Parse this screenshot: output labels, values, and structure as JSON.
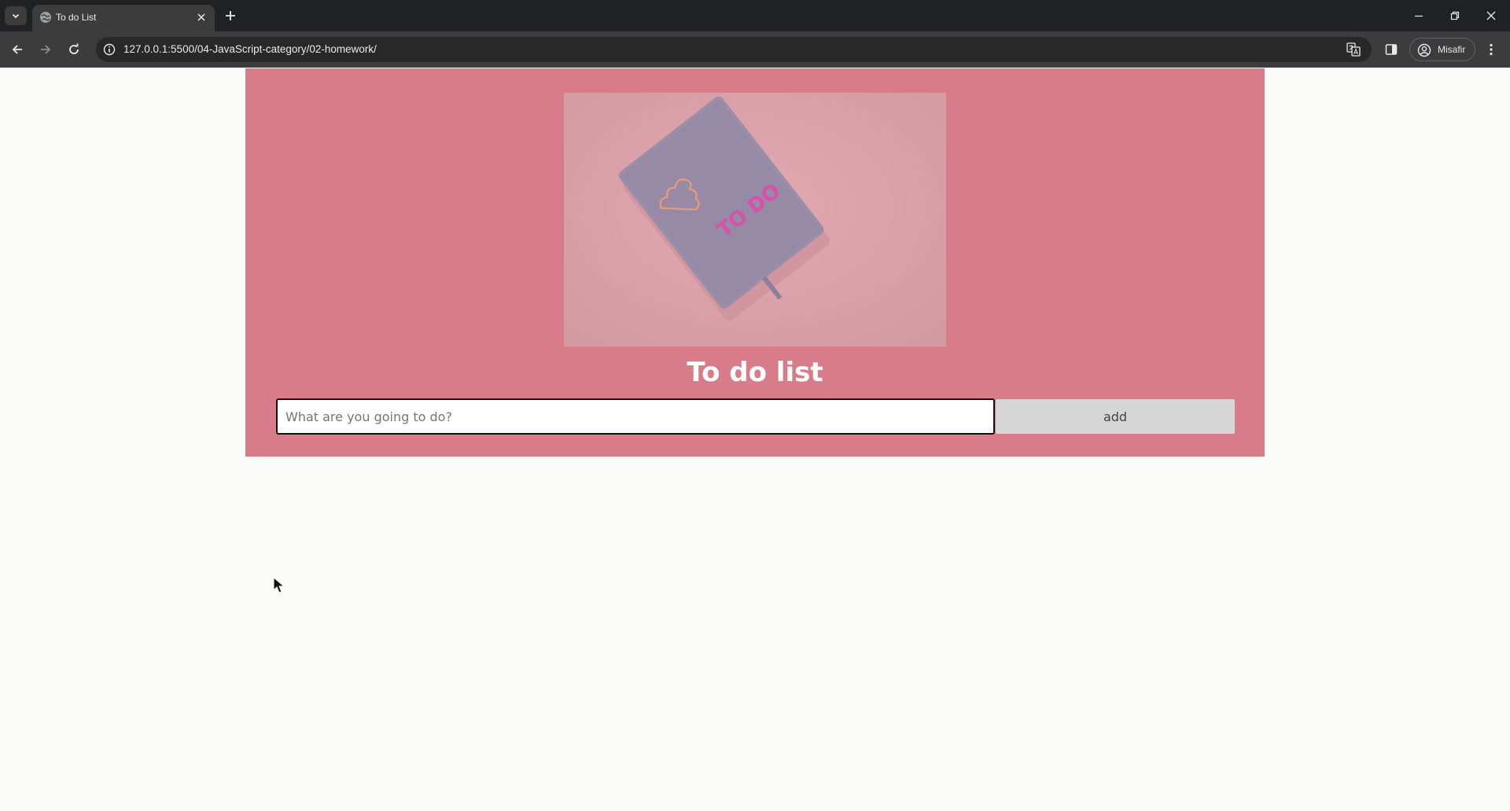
{
  "browser": {
    "tab": {
      "title": "To do List",
      "favicon": "globe-icon"
    },
    "address_bar": {
      "url": "127.0.0.1:5500/04-JavaScript-category/02-homework/",
      "info_icon": "info-icon"
    },
    "profile": {
      "label": "Misafir",
      "icon": "person-circle-icon"
    },
    "icons": {
      "tab_menu": "chevron-down-icon",
      "new_tab": "plus-icon",
      "minimize": "minimize-icon",
      "restore": "restore-icon",
      "close_window": "close-icon",
      "back": "arrow-left-icon",
      "forward": "arrow-right-icon",
      "reload": "reload-icon",
      "translate": "translate-icon",
      "side_panel": "side-panel-icon",
      "menu": "kebab-menu-icon"
    }
  },
  "page": {
    "hero": {
      "image_text": "TO DO",
      "title": "To do list"
    },
    "form": {
      "input_placeholder": "What are you going to do?",
      "input_value": "",
      "add_label": "add"
    }
  },
  "colors": {
    "hero_background": "#d87c89",
    "page_background": "#fbfbfa",
    "add_button": "#d6d6d6",
    "title_text": "#ffffff"
  }
}
